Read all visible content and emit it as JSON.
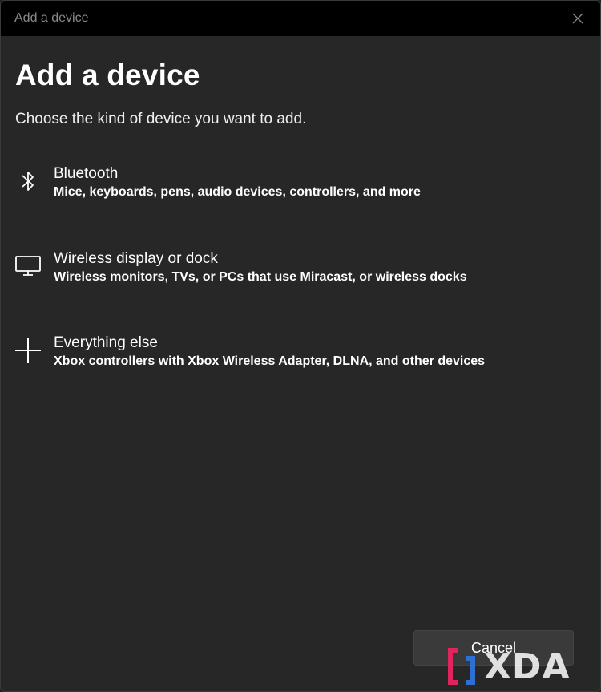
{
  "window": {
    "title": "Add a device",
    "close_icon": "close-icon"
  },
  "main": {
    "heading": "Add a device",
    "subheading": "Choose the kind of device you want to add.",
    "options": [
      {
        "icon": "bluetooth-icon",
        "label": "Bluetooth",
        "description": "Mice, keyboards, pens, audio devices, controllers, and more"
      },
      {
        "icon": "monitor-icon",
        "label": "Wireless display or dock",
        "description": "Wireless monitors, TVs, or PCs that use Miracast, or wireless docks"
      },
      {
        "icon": "plus-icon",
        "label": "Everything else",
        "description": "Xbox controllers with Xbox Wireless Adapter, DLNA, and other devices"
      }
    ]
  },
  "footer": {
    "cancel_label": "Cancel"
  },
  "watermark": {
    "text": "XDA",
    "icon": "xda-logo-icon"
  },
  "colors": {
    "background": "#272727",
    "titlebar": "#000000",
    "title_text": "#8a8a8a",
    "watermark_accent": "#e0245e",
    "watermark_accent2": "#2f6fd1"
  }
}
